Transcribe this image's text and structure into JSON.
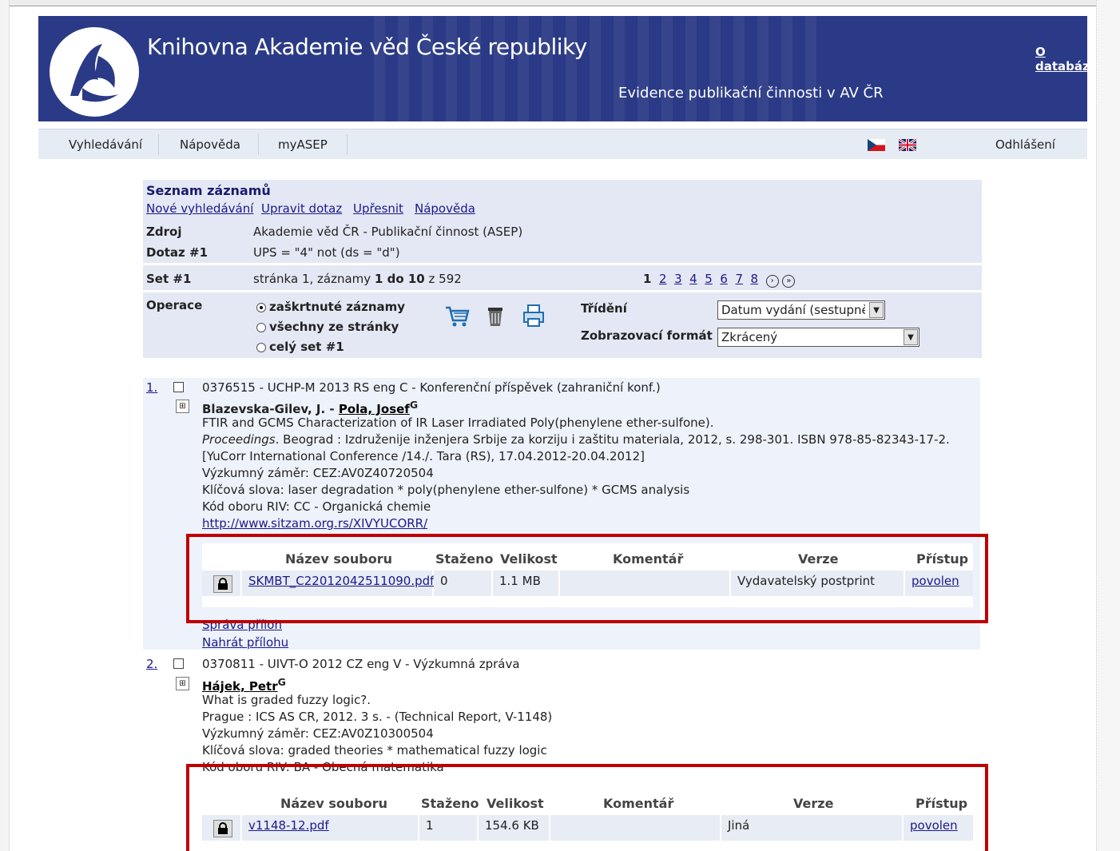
{
  "header": {
    "title": "Knihovna Akademie věd České republiky",
    "subtitle": "Evidence publikační činnosti v AV ČR",
    "about_link": "O databázi"
  },
  "nav": {
    "items": [
      "Vyhledávání",
      "Nápověda",
      "myASEP"
    ],
    "logout": "Odhlášení"
  },
  "panel": {
    "heading": "Seznam záznamů",
    "links": [
      "Nové vyhledávání",
      "Upravit dotaz",
      "Upřesnit",
      "Nápověda"
    ],
    "source_label": "Zdroj",
    "source_value": "Akademie věd ČR - Publikační činnost (ASEP)",
    "query_label": "Dotaz #1",
    "query_value": "UPS = \"4\" not (ds = \"d\")",
    "set_label": "Set #1",
    "set_prefix": "stránka 1, záznamy ",
    "set_range": "1 do 10",
    "set_suffix": " z 592",
    "pages": [
      "1",
      "2",
      "3",
      "4",
      "5",
      "6",
      "7",
      "8"
    ],
    "operations_label": "Operace",
    "radio_options": [
      "zaškrtnuté záznamy",
      "všechny ze stránky",
      "celý set #1"
    ],
    "sort_label": "Třídění",
    "sort_value": "Datum vydání (sestupně)",
    "format_label": "Zobrazovací formát",
    "format_value": "Zkrácený"
  },
  "records": [
    {
      "number": "1.",
      "code": "0376515 - UCHP-M 2013 RS eng C - Konferenční příspěvek (zahraniční konf.)",
      "author_plain": "Blazevska-Gilev, J. - ",
      "author_link": "Pola, Josef",
      "sup": "G",
      "title": "FTIR and GCMS Characterization of IR Laser Irradiated Poly(phenylene ether-sulfone).",
      "source_em": "Proceedings",
      "source_rest": ". Beograd : Izdruženije inženjera Srbije za korziju i zaštitu materiala, 2012, s. 298-301. ISBN 978-85-82343-17-2.",
      "conference": "[YuCorr International Conference /14./. Tara (RS), 17.04.2012-20.04.2012]",
      "research": "Výzkumný záměr: CEZ:AV0Z40720504",
      "keywords": "Klíčová slova: laser degradation * poly(phenylene ether-sulfone) * GCMS analysis",
      "riv": "Kód oboru RIV: CC - Organická chemie",
      "url": "http://www.sitzam.org.rs/XIVYUCORR/",
      "files": {
        "headers": [
          "Název souboru",
          "Staženo",
          "Velikost",
          "Komentář",
          "Verze",
          "Přístup"
        ],
        "row": {
          "name": "SKMBT_C22012042511090.pdf",
          "downloads": "0",
          "size": "1.1 MB",
          "comment": "",
          "version": "Vydavatelský postprint",
          "access": "povolen"
        }
      },
      "manage": "Správa příloh",
      "upload": "Nahrát přílohu"
    },
    {
      "number": "2.",
      "code": "0370811 - UIVT-O 2012 CZ eng V - Výzkumná zpráva",
      "author_link": "Hájek, Petr",
      "sup": "G",
      "title": "What is graded fuzzy logic?.",
      "source": "Prague : ICS AS CR, 2012. 3 s. - (Technical Report, V-1148)",
      "research": "Výzkumný záměr: CEZ:AV0Z10300504",
      "keywords": "Klíčová slova: graded theories * mathematical fuzzy logic",
      "riv": "Kód oboru RIV: BA - Obecná matematika",
      "files": {
        "headers": [
          "Název souboru",
          "Staženo",
          "Velikost",
          "Komentář",
          "Verze",
          "Přístup"
        ],
        "row": {
          "name": "v1148-12.pdf",
          "downloads": "1",
          "size": "154.6 KB",
          "comment": "",
          "version": "Jiná",
          "access": "povolen"
        }
      }
    }
  ],
  "colors": {
    "header_bg": "#2b3a86",
    "panel_bg": "#e4e8f4",
    "highlight_box": "#c00000",
    "link": "#1a1a8c"
  }
}
